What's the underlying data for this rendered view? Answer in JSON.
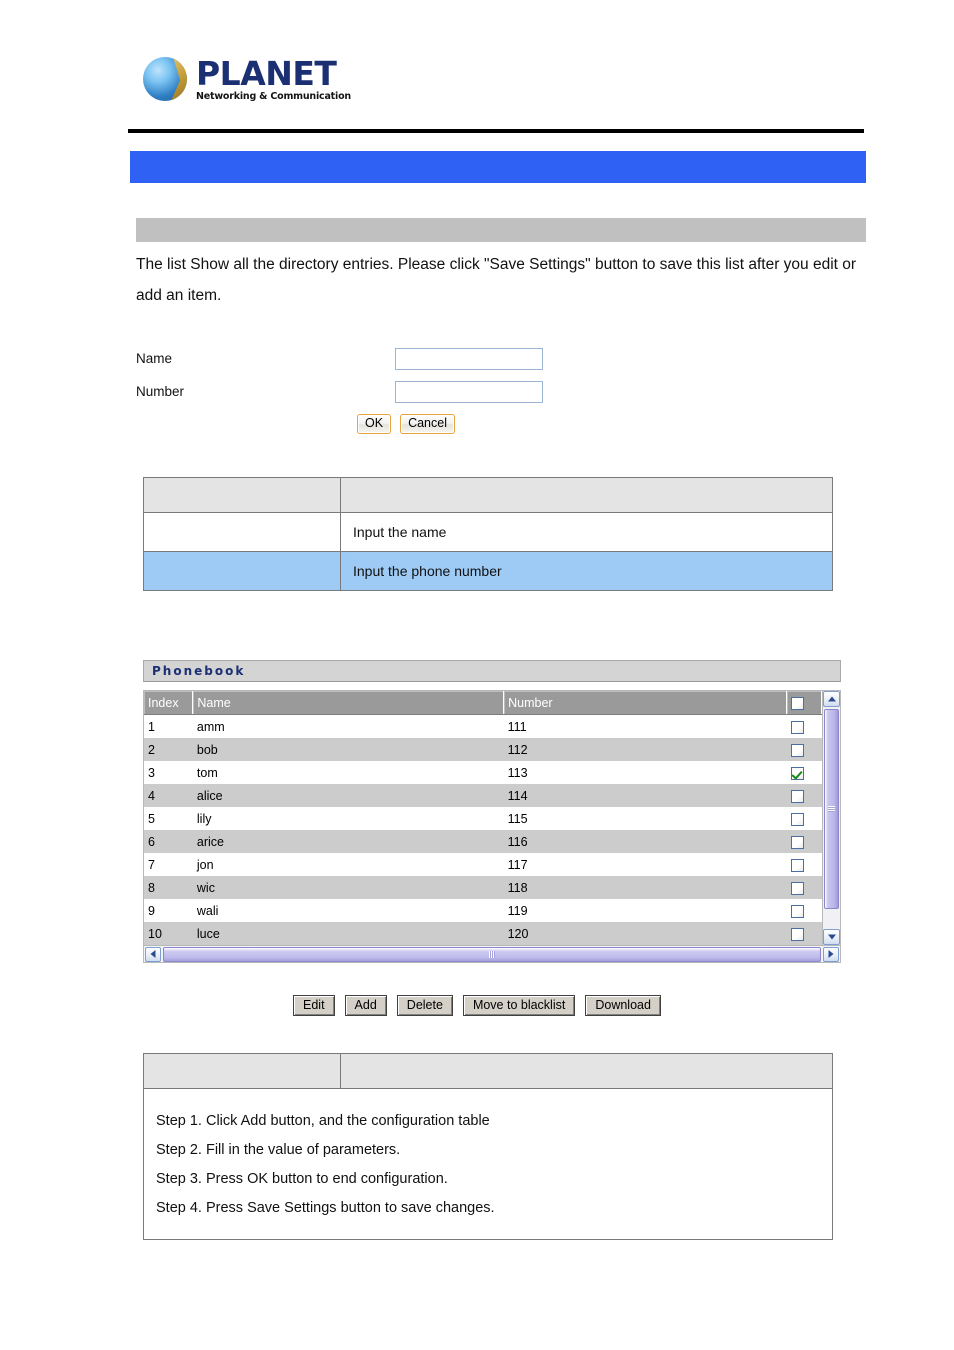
{
  "logo": {
    "brand": "PLANET",
    "tagline": "Networking & Communication"
  },
  "banners": {
    "title_bar_text": "",
    "section_bar_text": ""
  },
  "intro": {
    "text": "The list Show all the directory entries. Please click \"Save Settings\" button to save this list after you edit or add an item."
  },
  "form": {
    "fields": [
      {
        "label": "Name",
        "value": "",
        "placeholder": ""
      },
      {
        "label": "Number",
        "value": "",
        "placeholder": ""
      }
    ],
    "ok_label": "OK",
    "cancel_label": "Cancel"
  },
  "param_table": {
    "header": {
      "col1": "",
      "col2": ""
    },
    "rows": [
      {
        "name": "",
        "description": "Input the name",
        "highlight": false
      },
      {
        "name": "",
        "description": "Input the phone number",
        "highlight": true
      }
    ]
  },
  "phonebook": {
    "title": "Phonebook",
    "columns": [
      "Index",
      "Name",
      "Number",
      ""
    ],
    "rows": [
      {
        "index": "1",
        "name": "amm",
        "number": "111",
        "checked": false
      },
      {
        "index": "2",
        "name": "bob",
        "number": "112",
        "checked": false
      },
      {
        "index": "3",
        "name": "tom",
        "number": "113",
        "checked": true
      },
      {
        "index": "4",
        "name": "alice",
        "number": "114",
        "checked": false
      },
      {
        "index": "5",
        "name": "lily",
        "number": "115",
        "checked": false
      },
      {
        "index": "6",
        "name": "arice",
        "number": "116",
        "checked": false
      },
      {
        "index": "7",
        "name": "jon",
        "number": "117",
        "checked": false
      },
      {
        "index": "8",
        "name": "wic",
        "number": "118",
        "checked": false
      },
      {
        "index": "9",
        "name": "wali",
        "number": "119",
        "checked": false
      },
      {
        "index": "10",
        "name": "luce",
        "number": "120",
        "checked": false
      }
    ],
    "buttons": [
      "Edit",
      "Add",
      "Delete",
      "Move to blacklist",
      "Download"
    ]
  },
  "steps_table": {
    "header": {
      "col1": "",
      "col2": ""
    },
    "steps": [
      "Step 1. Click Add button, and the configuration table",
      "Step 2. Fill in the value of parameters.",
      "Step 3. Press OK button to end configuration.",
      "Step 4. Press Save Settings button to save changes."
    ]
  },
  "colors": {
    "banner_blue": "#2f61f5",
    "section_gray": "#c0c0c0",
    "row_highlight_blue": "#9ecbf5",
    "table_header_gray": "#e4e4e4",
    "grid_header_gray": "#9a9a9a",
    "grid_alt_row": "#cccccc",
    "logo_navy": "#1b2f73",
    "check_green": "#158a17"
  }
}
